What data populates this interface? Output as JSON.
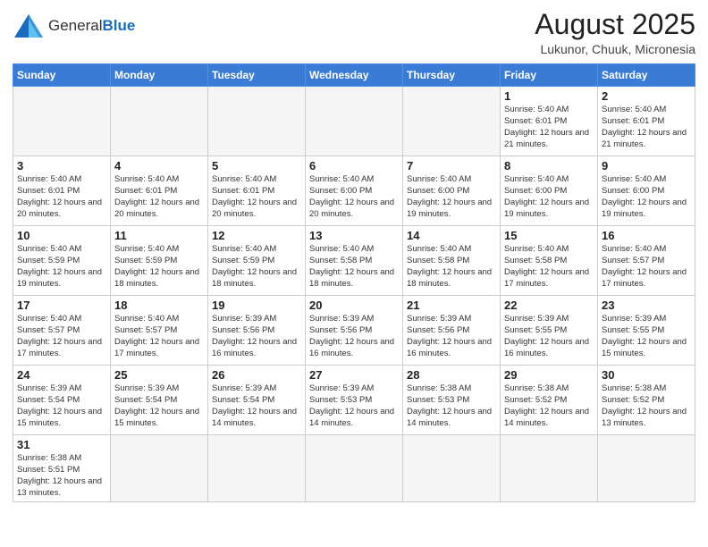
{
  "logo": {
    "text_general": "General",
    "text_blue": "Blue"
  },
  "title": "August 2025",
  "location": "Lukunor, Chuuk, Micronesia",
  "weekdays": [
    "Sunday",
    "Monday",
    "Tuesday",
    "Wednesday",
    "Thursday",
    "Friday",
    "Saturday"
  ],
  "weeks": [
    [
      {
        "day": "",
        "info": ""
      },
      {
        "day": "",
        "info": ""
      },
      {
        "day": "",
        "info": ""
      },
      {
        "day": "",
        "info": ""
      },
      {
        "day": "",
        "info": ""
      },
      {
        "day": "1",
        "info": "Sunrise: 5:40 AM\nSunset: 6:01 PM\nDaylight: 12 hours\nand 21 minutes."
      },
      {
        "day": "2",
        "info": "Sunrise: 5:40 AM\nSunset: 6:01 PM\nDaylight: 12 hours\nand 21 minutes."
      }
    ],
    [
      {
        "day": "3",
        "info": "Sunrise: 5:40 AM\nSunset: 6:01 PM\nDaylight: 12 hours\nand 20 minutes."
      },
      {
        "day": "4",
        "info": "Sunrise: 5:40 AM\nSunset: 6:01 PM\nDaylight: 12 hours\nand 20 minutes."
      },
      {
        "day": "5",
        "info": "Sunrise: 5:40 AM\nSunset: 6:01 PM\nDaylight: 12 hours\nand 20 minutes."
      },
      {
        "day": "6",
        "info": "Sunrise: 5:40 AM\nSunset: 6:00 PM\nDaylight: 12 hours\nand 20 minutes."
      },
      {
        "day": "7",
        "info": "Sunrise: 5:40 AM\nSunset: 6:00 PM\nDaylight: 12 hours\nand 19 minutes."
      },
      {
        "day": "8",
        "info": "Sunrise: 5:40 AM\nSunset: 6:00 PM\nDaylight: 12 hours\nand 19 minutes."
      },
      {
        "day": "9",
        "info": "Sunrise: 5:40 AM\nSunset: 6:00 PM\nDaylight: 12 hours\nand 19 minutes."
      }
    ],
    [
      {
        "day": "10",
        "info": "Sunrise: 5:40 AM\nSunset: 5:59 PM\nDaylight: 12 hours\nand 19 minutes."
      },
      {
        "day": "11",
        "info": "Sunrise: 5:40 AM\nSunset: 5:59 PM\nDaylight: 12 hours\nand 18 minutes."
      },
      {
        "day": "12",
        "info": "Sunrise: 5:40 AM\nSunset: 5:59 PM\nDaylight: 12 hours\nand 18 minutes."
      },
      {
        "day": "13",
        "info": "Sunrise: 5:40 AM\nSunset: 5:58 PM\nDaylight: 12 hours\nand 18 minutes."
      },
      {
        "day": "14",
        "info": "Sunrise: 5:40 AM\nSunset: 5:58 PM\nDaylight: 12 hours\nand 18 minutes."
      },
      {
        "day": "15",
        "info": "Sunrise: 5:40 AM\nSunset: 5:58 PM\nDaylight: 12 hours\nand 17 minutes."
      },
      {
        "day": "16",
        "info": "Sunrise: 5:40 AM\nSunset: 5:57 PM\nDaylight: 12 hours\nand 17 minutes."
      }
    ],
    [
      {
        "day": "17",
        "info": "Sunrise: 5:40 AM\nSunset: 5:57 PM\nDaylight: 12 hours\nand 17 minutes."
      },
      {
        "day": "18",
        "info": "Sunrise: 5:40 AM\nSunset: 5:57 PM\nDaylight: 12 hours\nand 17 minutes."
      },
      {
        "day": "19",
        "info": "Sunrise: 5:39 AM\nSunset: 5:56 PM\nDaylight: 12 hours\nand 16 minutes."
      },
      {
        "day": "20",
        "info": "Sunrise: 5:39 AM\nSunset: 5:56 PM\nDaylight: 12 hours\nand 16 minutes."
      },
      {
        "day": "21",
        "info": "Sunrise: 5:39 AM\nSunset: 5:56 PM\nDaylight: 12 hours\nand 16 minutes."
      },
      {
        "day": "22",
        "info": "Sunrise: 5:39 AM\nSunset: 5:55 PM\nDaylight: 12 hours\nand 16 minutes."
      },
      {
        "day": "23",
        "info": "Sunrise: 5:39 AM\nSunset: 5:55 PM\nDaylight: 12 hours\nand 15 minutes."
      }
    ],
    [
      {
        "day": "24",
        "info": "Sunrise: 5:39 AM\nSunset: 5:54 PM\nDaylight: 12 hours\nand 15 minutes."
      },
      {
        "day": "25",
        "info": "Sunrise: 5:39 AM\nSunset: 5:54 PM\nDaylight: 12 hours\nand 15 minutes."
      },
      {
        "day": "26",
        "info": "Sunrise: 5:39 AM\nSunset: 5:54 PM\nDaylight: 12 hours\nand 14 minutes."
      },
      {
        "day": "27",
        "info": "Sunrise: 5:39 AM\nSunset: 5:53 PM\nDaylight: 12 hours\nand 14 minutes."
      },
      {
        "day": "28",
        "info": "Sunrise: 5:38 AM\nSunset: 5:53 PM\nDaylight: 12 hours\nand 14 minutes."
      },
      {
        "day": "29",
        "info": "Sunrise: 5:38 AM\nSunset: 5:52 PM\nDaylight: 12 hours\nand 14 minutes."
      },
      {
        "day": "30",
        "info": "Sunrise: 5:38 AM\nSunset: 5:52 PM\nDaylight: 12 hours\nand 13 minutes."
      }
    ],
    [
      {
        "day": "31",
        "info": "Sunrise: 5:38 AM\nSunset: 5:51 PM\nDaylight: 12 hours\nand 13 minutes."
      },
      {
        "day": "",
        "info": ""
      },
      {
        "day": "",
        "info": ""
      },
      {
        "day": "",
        "info": ""
      },
      {
        "day": "",
        "info": ""
      },
      {
        "day": "",
        "info": ""
      },
      {
        "day": "",
        "info": ""
      }
    ]
  ]
}
